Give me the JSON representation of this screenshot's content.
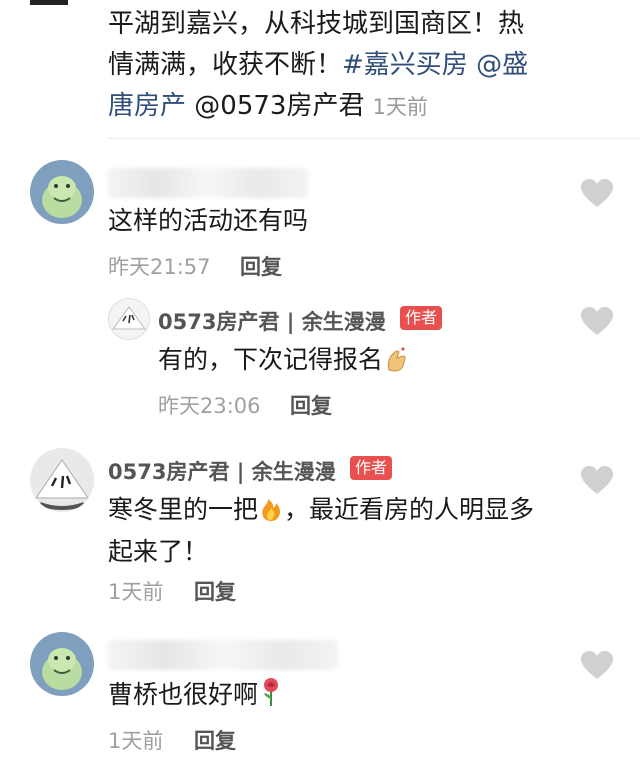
{
  "post": {
    "text_part1": "平湖到嘉兴，从科技城到国商区！热情满满，收获不断！",
    "hashtag": "#嘉兴买房",
    "mention1": "@盛唐房产",
    "mention2": "@0573房产君",
    "time": "1天前"
  },
  "comments": [
    {
      "text": "这样的活动还有吗",
      "time": "昨天21:57",
      "reply_label": "回复",
      "icon": "jade-cabbage-avatar"
    },
    {
      "author": "0573房产君 | 余生漫漫",
      "badge": "作者",
      "text": "有的，下次记得报名",
      "emoji": "finger-heart-emoji",
      "time": "昨天23:06",
      "reply_label": "回复"
    },
    {
      "author": "0573房产君 | 余生漫漫",
      "badge": "作者",
      "text_part1": "寒冬里的一把",
      "emoji": "fire-emoji",
      "text_part2": "，最近看房的人明显多起来了！",
      "time": "1天前",
      "reply_label": "回复"
    },
    {
      "text": "曹桥也很好啊",
      "emoji": "rose-emoji",
      "time": "1天前",
      "reply_label": "回复"
    }
  ],
  "colors": {
    "hashtag": "#2f4e7a",
    "badge_bg": "#e8504f",
    "meta": "#a0a0a0",
    "heart": "#d0d0d0"
  }
}
